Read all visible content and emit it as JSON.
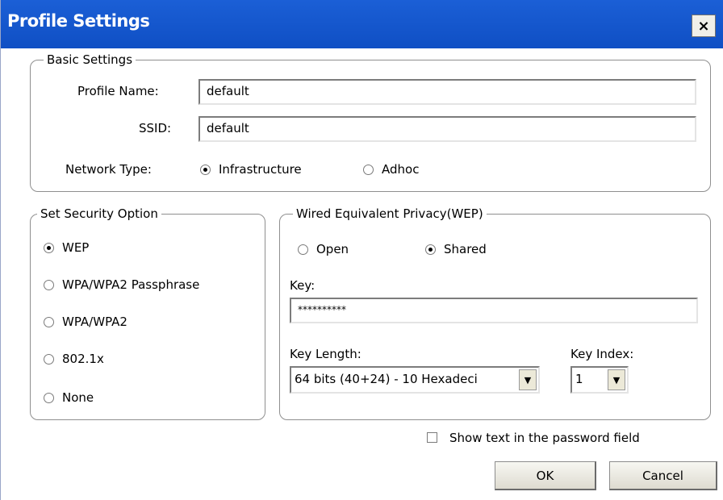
{
  "window": {
    "title": "Profile Settings",
    "close_label": "×"
  },
  "basic": {
    "legend": "Basic Settings",
    "profile_name_label": "Profile Name:",
    "profile_name_value": "default",
    "ssid_label": "SSID:",
    "ssid_value": "default",
    "network_type_label": "Network Type:",
    "network_options": [
      {
        "label": "Infrastructure",
        "selected": true
      },
      {
        "label": "Adhoc",
        "selected": false
      }
    ]
  },
  "security": {
    "legend": "Set Security Option",
    "options": [
      {
        "label": "WEP",
        "selected": true
      },
      {
        "label": "WPA/WPA2 Passphrase",
        "selected": false
      },
      {
        "label": "WPA/WPA2",
        "selected": false
      },
      {
        "label": "802.1x",
        "selected": false
      },
      {
        "label": "None",
        "selected": false
      }
    ]
  },
  "wep": {
    "legend": "Wired Equivalent Privacy(WEP)",
    "auth_options": [
      {
        "label": "Open",
        "selected": false
      },
      {
        "label": "Shared",
        "selected": true
      }
    ],
    "key_label": "Key:",
    "key_value": "**********",
    "key_length_label": "Key Length:",
    "key_length_value": "64 bits (40+24) - 10 Hexadeci",
    "key_index_label": "Key Index:",
    "key_index_value": "1"
  },
  "show_password": {
    "label": "Show text in the password field",
    "checked": false
  },
  "buttons": {
    "ok": "OK",
    "cancel": "Cancel"
  }
}
